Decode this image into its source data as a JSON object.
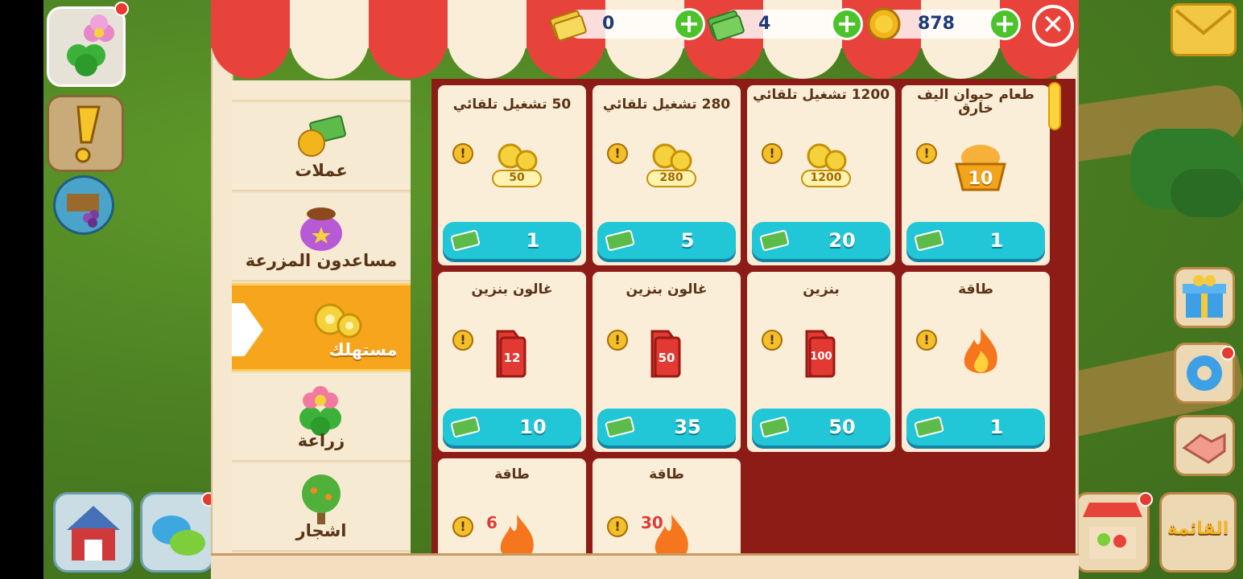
{
  "currencies": [
    {
      "name": "cash-bundle",
      "value": "0",
      "color": "#f2c83a"
    },
    {
      "name": "cash-money",
      "value": "4",
      "color": "#4caf50"
    },
    {
      "name": "coins",
      "value": "878",
      "color": "#f2b51c"
    }
  ],
  "categories": [
    {
      "label": "عملات",
      "icon": "cash-coins-icon",
      "active": false
    },
    {
      "label": "مساعدون المزرعة",
      "icon": "magic-bag-icon",
      "active": false
    },
    {
      "label": "مستهلك",
      "icon": "gears-icon",
      "active": true
    },
    {
      "label": "زراعة",
      "icon": "flower-icon",
      "active": false
    },
    {
      "label": "اشجار",
      "icon": "tree-icon",
      "active": false
    }
  ],
  "items": [
    {
      "title": "50 تشغيل تلقائي",
      "price": "1",
      "icon": "autorun-gears-icon",
      "badge": "50"
    },
    {
      "title": "280 تشغيل تلقائي",
      "price": "5",
      "icon": "autorun-gears-icon",
      "badge": "280"
    },
    {
      "title": "1200 تشغيل تلقائي",
      "price": "20",
      "icon": "autorun-gears-icon",
      "badge": "1200"
    },
    {
      "title": "طعام حيوان اليف خارق",
      "price": "1",
      "icon": "pet-food-bowl-icon",
      "badge": "10"
    },
    {
      "title": "غالون بنزين",
      "price": "10",
      "icon": "fuel-can-icon",
      "badge": "12"
    },
    {
      "title": "غالون بنزين",
      "price": "35",
      "icon": "fuel-can-icon",
      "badge": "50"
    },
    {
      "title": "بنزين",
      "price": "50",
      "icon": "fuel-can-icon",
      "badge": "100"
    },
    {
      "title": "طاقة",
      "price": "1",
      "icon": "fire-icon",
      "badge": ""
    },
    {
      "title": "طاقة",
      "price": "",
      "icon": "fire-icon",
      "badge": "6"
    },
    {
      "title": "طاقة",
      "price": "",
      "icon": "fire-icon",
      "badge": "30"
    }
  ],
  "menu_label": "القائمة",
  "info_glyph": "!",
  "plus_glyph": "+",
  "close_glyph": "✕"
}
